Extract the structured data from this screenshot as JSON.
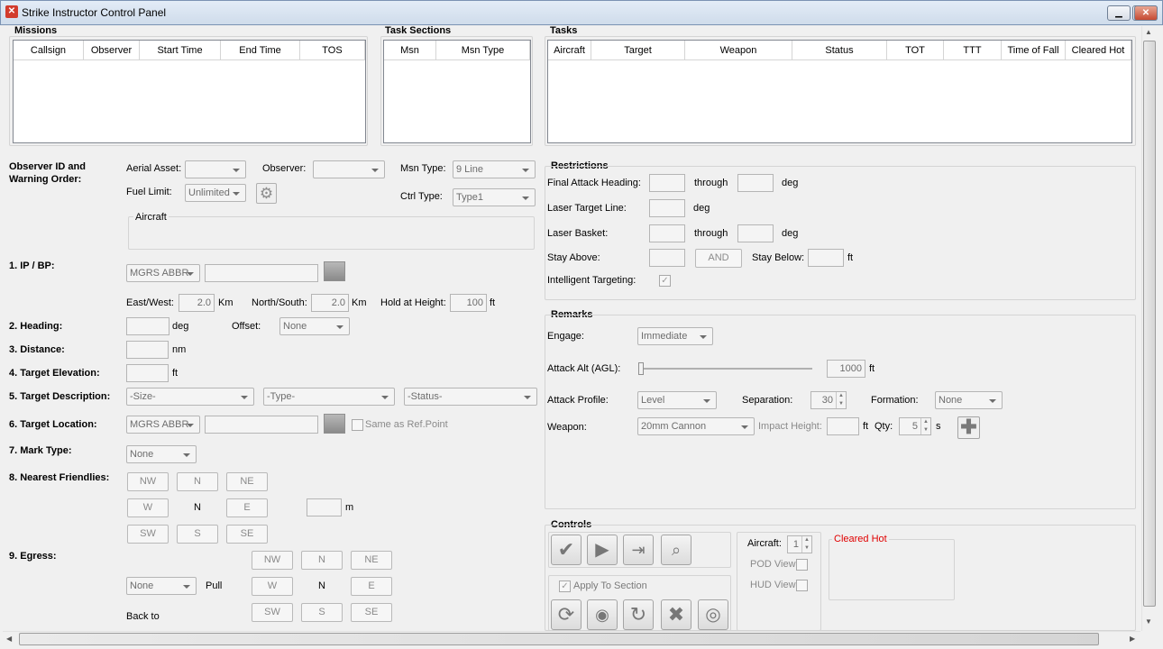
{
  "window": {
    "title": "Strike Instructor Control Panel",
    "min_label": "▁",
    "max_label": "▭",
    "close_label": "✕"
  },
  "missions": {
    "title": "Missions",
    "columns": [
      "Callsign",
      "Observer",
      "Start Time",
      "End Time",
      "TOS"
    ]
  },
  "task_sections": {
    "title": "Task Sections",
    "columns": [
      "Msn",
      "Msn Type"
    ]
  },
  "tasks": {
    "title": "Tasks",
    "columns": [
      "Aircraft",
      "Target",
      "Weapon",
      "Status",
      "TOT",
      "TTT",
      "Time of Fall",
      "Cleared Hot"
    ]
  },
  "observer": {
    "heading": "Observer ID and Warning Order:",
    "aerial_asset_label": "Aerial Asset:",
    "observer_label": "Observer:",
    "msn_type_label": "Msn Type:",
    "msn_type_value": "9 Line",
    "fuel_limit_label": "Fuel Limit:",
    "fuel_limit_value": "Unlimited",
    "ctrl_type_label": "Ctrl Type:",
    "ctrl_type_value": "Type1",
    "aircraft_group": "Aircraft"
  },
  "ip_bp": {
    "label": "1. IP / BP:",
    "coord_type": "MGRS ABBR",
    "east_west_label": "East/West:",
    "east_west_value": "2.0",
    "km1": "Km",
    "north_south_label": "North/South:",
    "north_south_value": "2.0",
    "km2": "Km",
    "hold_label": "Hold at Height:",
    "hold_value": "100",
    "ft": "ft"
  },
  "heading": {
    "label": "2. Heading:",
    "unit": "deg",
    "offset_label": "Offset:",
    "offset_value": "None"
  },
  "distance": {
    "label": "3. Distance:",
    "unit": "nm"
  },
  "elevation": {
    "label": "4. Target Elevation:",
    "unit": "ft"
  },
  "description": {
    "label": "5. Target Description:",
    "size": "-Size-",
    "type": "-Type-",
    "status": "-Status-"
  },
  "location": {
    "label": "6. Target Location:",
    "coord_type": "MGRS ABBR",
    "same_as_ref": "Same as Ref.Point"
  },
  "mark": {
    "label": "7. Mark Type:",
    "value": "None"
  },
  "friendlies": {
    "label": "8. Nearest Friendlies:",
    "nw": "NW",
    "n": "N",
    "ne": "NE",
    "w": "W",
    "center": "N",
    "e": "E",
    "sw": "SW",
    "s": "S",
    "se": "SE",
    "unit": "m"
  },
  "egress": {
    "label": "9. Egress:",
    "nw": "NW",
    "n": "N",
    "ne": "NE",
    "w": "W",
    "center": "N",
    "e": "E",
    "sw": "SW",
    "s": "S",
    "se": "SE",
    "combo": "None",
    "pull": "Pull",
    "back_to": "Back to"
  },
  "restrictions": {
    "title": "Restrictions",
    "final_attack_label": "Final Attack Heading:",
    "through1": "through",
    "deg1": "deg",
    "laser_line_label": "Laser Target Line:",
    "deg2": "deg",
    "laser_basket_label": "Laser Basket:",
    "through2": "through",
    "deg3": "deg",
    "stay_above_label": "Stay Above:",
    "and_label": "AND",
    "stay_below_label": "Stay Below:",
    "ft": "ft",
    "intelligent_label": "Intelligent Targeting:"
  },
  "remarks": {
    "title": "Remarks",
    "engage_label": "Engage:",
    "engage_value": "Immediate",
    "attack_alt_label": "Attack Alt (AGL):",
    "attack_alt_value": "1000",
    "attack_alt_unit": "ft",
    "profile_label": "Attack Profile:",
    "profile_value": "Level",
    "separation_label": "Separation:",
    "separation_value": "30",
    "formation_label": "Formation:",
    "formation_value": "None",
    "weapon_label": "Weapon:",
    "weapon_value": "20mm Cannon",
    "impact_label": "Impact Height:",
    "impact_unit": "ft",
    "qty_label": "Qty:",
    "qty_value": "5",
    "qty_unit": "s"
  },
  "controls": {
    "title": "Controls",
    "apply_label": "Apply To Section",
    "aircraft_label": "Aircraft:",
    "aircraft_value": "1",
    "pod_label": "POD View",
    "hud_label": "HUD View",
    "status_text": "Cleared Hot",
    "status_color": "#e00000"
  }
}
